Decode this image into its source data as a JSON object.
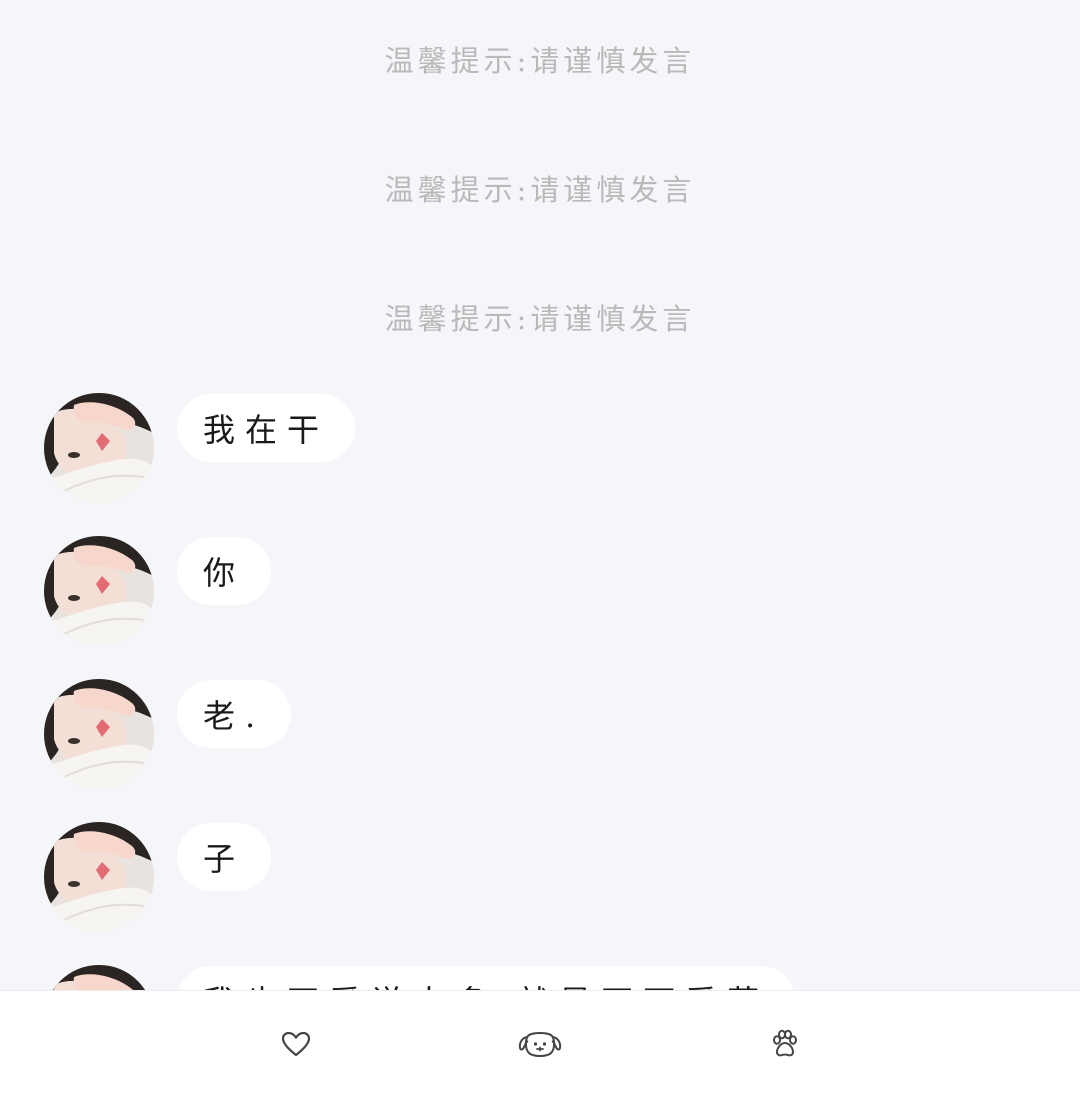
{
  "notices": [
    "温馨提示:请谨慎发言",
    "温馨提示:请谨慎发言",
    "温馨提示:请谨慎发言"
  ],
  "messages": [
    {
      "text": "我在干",
      "avatar": "user-avatar"
    },
    {
      "text": "你",
      "avatar": "user-avatar"
    },
    {
      "text": "老.",
      "avatar": "user-avatar"
    },
    {
      "text": "子",
      "avatar": "user-avatar"
    },
    {
      "text": "我也不爱说太多 就是不可爱荣",
      "avatar": "user-avatar"
    }
  ],
  "tabbar": {
    "items": [
      {
        "icon": "heart-icon"
      },
      {
        "icon": "dog-face-icon"
      },
      {
        "icon": "paw-icon"
      }
    ]
  },
  "colors": {
    "background": "#f4f6f9",
    "bubble": "#ffffff",
    "notice_text": "#b9b9b9",
    "message_text": "#1a1a1a",
    "icon": "#444444"
  }
}
